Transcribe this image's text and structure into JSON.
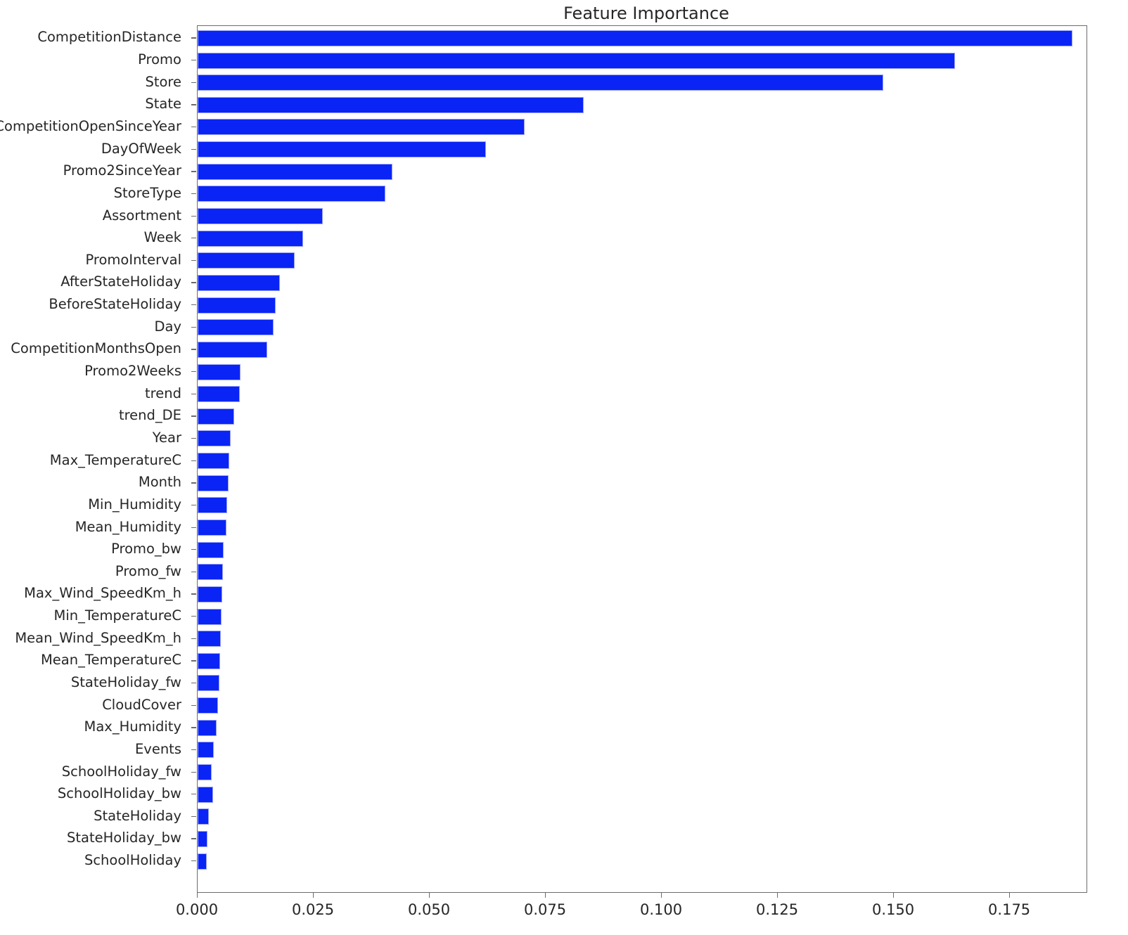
{
  "chart_data": {
    "type": "bar",
    "orientation": "horizontal",
    "title": "Feature Importance",
    "xlabel": "",
    "ylabel": "",
    "xlim": [
      0.0,
      0.1918
    ],
    "grid": false,
    "legend": null,
    "bar_color": "#0a24f5",
    "bar_edge_color": "#9aa3f8",
    "xticks": [
      0.0,
      0.025,
      0.05,
      0.075,
      0.1,
      0.125,
      0.15,
      0.175
    ],
    "xtick_labels": [
      "0.000",
      "0.025",
      "0.050",
      "0.075",
      "0.100",
      "0.125",
      "0.150",
      "0.175"
    ],
    "categories": [
      "CompetitionDistance",
      "Promo",
      "Store",
      "State",
      "CompetitionOpenSinceYear",
      "DayOfWeek",
      "Promo2SinceYear",
      "StoreType",
      "Assortment",
      "Week",
      "PromoInterval",
      "AfterStateHoliday",
      "BeforeStateHoliday",
      "Day",
      "CompetitionMonthsOpen",
      "Promo2Weeks",
      "trend",
      "trend_DE",
      "Year",
      "Max_TemperatureC",
      "Month",
      "Min_Humidity",
      "Mean_Humidity",
      "Promo_bw",
      "Promo_fw",
      "Max_Wind_SpeedKm_h",
      "Min_TemperatureC",
      "Mean_Wind_SpeedKm_h",
      "Mean_TemperatureC",
      "StateHoliday_fw",
      "CloudCover",
      "Max_Humidity",
      "Events",
      "SchoolHoliday_fw",
      "SchoolHoliday_bw",
      "StateHoliday",
      "StateHoliday_bw",
      "SchoolHoliday"
    ],
    "values": [
      0.1885,
      0.1632,
      0.1477,
      0.0832,
      0.0705,
      0.0621,
      0.042,
      0.0404,
      0.027,
      0.0227,
      0.0209,
      0.0177,
      0.0168,
      0.0164,
      0.015,
      0.0092,
      0.0091,
      0.0079,
      0.0071,
      0.0068,
      0.0067,
      0.0064,
      0.0062,
      0.0056,
      0.0054,
      0.0053,
      0.0051,
      0.005,
      0.0049,
      0.0047,
      0.0044,
      0.0041,
      0.0035,
      0.003,
      0.0033,
      0.0024,
      0.0021,
      0.0019
    ]
  }
}
